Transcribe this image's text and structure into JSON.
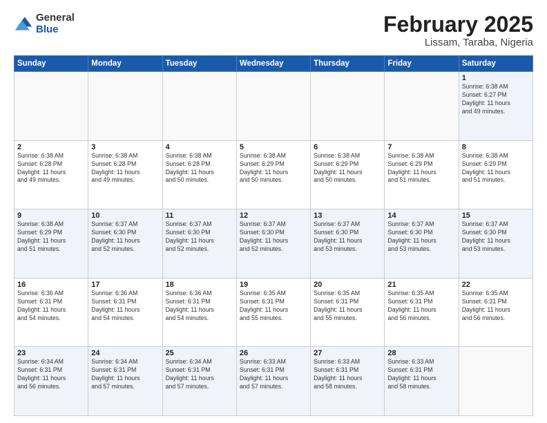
{
  "logo": {
    "general": "General",
    "blue": "Blue"
  },
  "title": {
    "month_year": "February 2025",
    "location": "Lissam, Taraba, Nigeria"
  },
  "days_of_week": [
    "Sunday",
    "Monday",
    "Tuesday",
    "Wednesday",
    "Thursday",
    "Friday",
    "Saturday"
  ],
  "weeks": [
    [
      {
        "day": "",
        "info": ""
      },
      {
        "day": "",
        "info": ""
      },
      {
        "day": "",
        "info": ""
      },
      {
        "day": "",
        "info": ""
      },
      {
        "day": "",
        "info": ""
      },
      {
        "day": "",
        "info": ""
      },
      {
        "day": "1",
        "info": "Sunrise: 6:38 AM\nSunset: 6:27 PM\nDaylight: 11 hours\nand 49 minutes."
      }
    ],
    [
      {
        "day": "2",
        "info": "Sunrise: 6:38 AM\nSunset: 6:28 PM\nDaylight: 11 hours\nand 49 minutes."
      },
      {
        "day": "3",
        "info": "Sunrise: 6:38 AM\nSunset: 6:28 PM\nDaylight: 11 hours\nand 49 minutes."
      },
      {
        "day": "4",
        "info": "Sunrise: 6:38 AM\nSunset: 6:28 PM\nDaylight: 11 hours\nand 50 minutes."
      },
      {
        "day": "5",
        "info": "Sunrise: 6:38 AM\nSunset: 6:29 PM\nDaylight: 11 hours\nand 50 minutes."
      },
      {
        "day": "6",
        "info": "Sunrise: 6:38 AM\nSunset: 6:29 PM\nDaylight: 11 hours\nand 50 minutes."
      },
      {
        "day": "7",
        "info": "Sunrise: 6:38 AM\nSunset: 6:29 PM\nDaylight: 11 hours\nand 51 minutes."
      },
      {
        "day": "8",
        "info": "Sunrise: 6:38 AM\nSunset: 6:29 PM\nDaylight: 11 hours\nand 51 minutes."
      }
    ],
    [
      {
        "day": "9",
        "info": "Sunrise: 6:38 AM\nSunset: 6:29 PM\nDaylight: 11 hours\nand 51 minutes."
      },
      {
        "day": "10",
        "info": "Sunrise: 6:37 AM\nSunset: 6:30 PM\nDaylight: 11 hours\nand 52 minutes."
      },
      {
        "day": "11",
        "info": "Sunrise: 6:37 AM\nSunset: 6:30 PM\nDaylight: 11 hours\nand 52 minutes."
      },
      {
        "day": "12",
        "info": "Sunrise: 6:37 AM\nSunset: 6:30 PM\nDaylight: 11 hours\nand 52 minutes."
      },
      {
        "day": "13",
        "info": "Sunrise: 6:37 AM\nSunset: 6:30 PM\nDaylight: 11 hours\nand 53 minutes."
      },
      {
        "day": "14",
        "info": "Sunrise: 6:37 AM\nSunset: 6:30 PM\nDaylight: 11 hours\nand 53 minutes."
      },
      {
        "day": "15",
        "info": "Sunrise: 6:37 AM\nSunset: 6:30 PM\nDaylight: 11 hours\nand 53 minutes."
      }
    ],
    [
      {
        "day": "16",
        "info": "Sunrise: 6:36 AM\nSunset: 6:31 PM\nDaylight: 11 hours\nand 54 minutes."
      },
      {
        "day": "17",
        "info": "Sunrise: 6:36 AM\nSunset: 6:31 PM\nDaylight: 11 hours\nand 54 minutes."
      },
      {
        "day": "18",
        "info": "Sunrise: 6:36 AM\nSunset: 6:31 PM\nDaylight: 11 hours\nand 54 minutes."
      },
      {
        "day": "19",
        "info": "Sunrise: 6:35 AM\nSunset: 6:31 PM\nDaylight: 11 hours\nand 55 minutes."
      },
      {
        "day": "20",
        "info": "Sunrise: 6:35 AM\nSunset: 6:31 PM\nDaylight: 11 hours\nand 55 minutes."
      },
      {
        "day": "21",
        "info": "Sunrise: 6:35 AM\nSunset: 6:31 PM\nDaylight: 11 hours\nand 56 minutes."
      },
      {
        "day": "22",
        "info": "Sunrise: 6:35 AM\nSunset: 6:31 PM\nDaylight: 11 hours\nand 56 minutes."
      }
    ],
    [
      {
        "day": "23",
        "info": "Sunrise: 6:34 AM\nSunset: 6:31 PM\nDaylight: 11 hours\nand 56 minutes."
      },
      {
        "day": "24",
        "info": "Sunrise: 6:34 AM\nSunset: 6:31 PM\nDaylight: 11 hours\nand 57 minutes."
      },
      {
        "day": "25",
        "info": "Sunrise: 6:34 AM\nSunset: 6:31 PM\nDaylight: 11 hours\nand 57 minutes."
      },
      {
        "day": "26",
        "info": "Sunrise: 6:33 AM\nSunset: 6:31 PM\nDaylight: 11 hours\nand 57 minutes."
      },
      {
        "day": "27",
        "info": "Sunrise: 6:33 AM\nSunset: 6:31 PM\nDaylight: 11 hours\nand 58 minutes."
      },
      {
        "day": "28",
        "info": "Sunrise: 6:33 AM\nSunset: 6:31 PM\nDaylight: 11 hours\nand 58 minutes."
      },
      {
        "day": "",
        "info": ""
      }
    ]
  ]
}
